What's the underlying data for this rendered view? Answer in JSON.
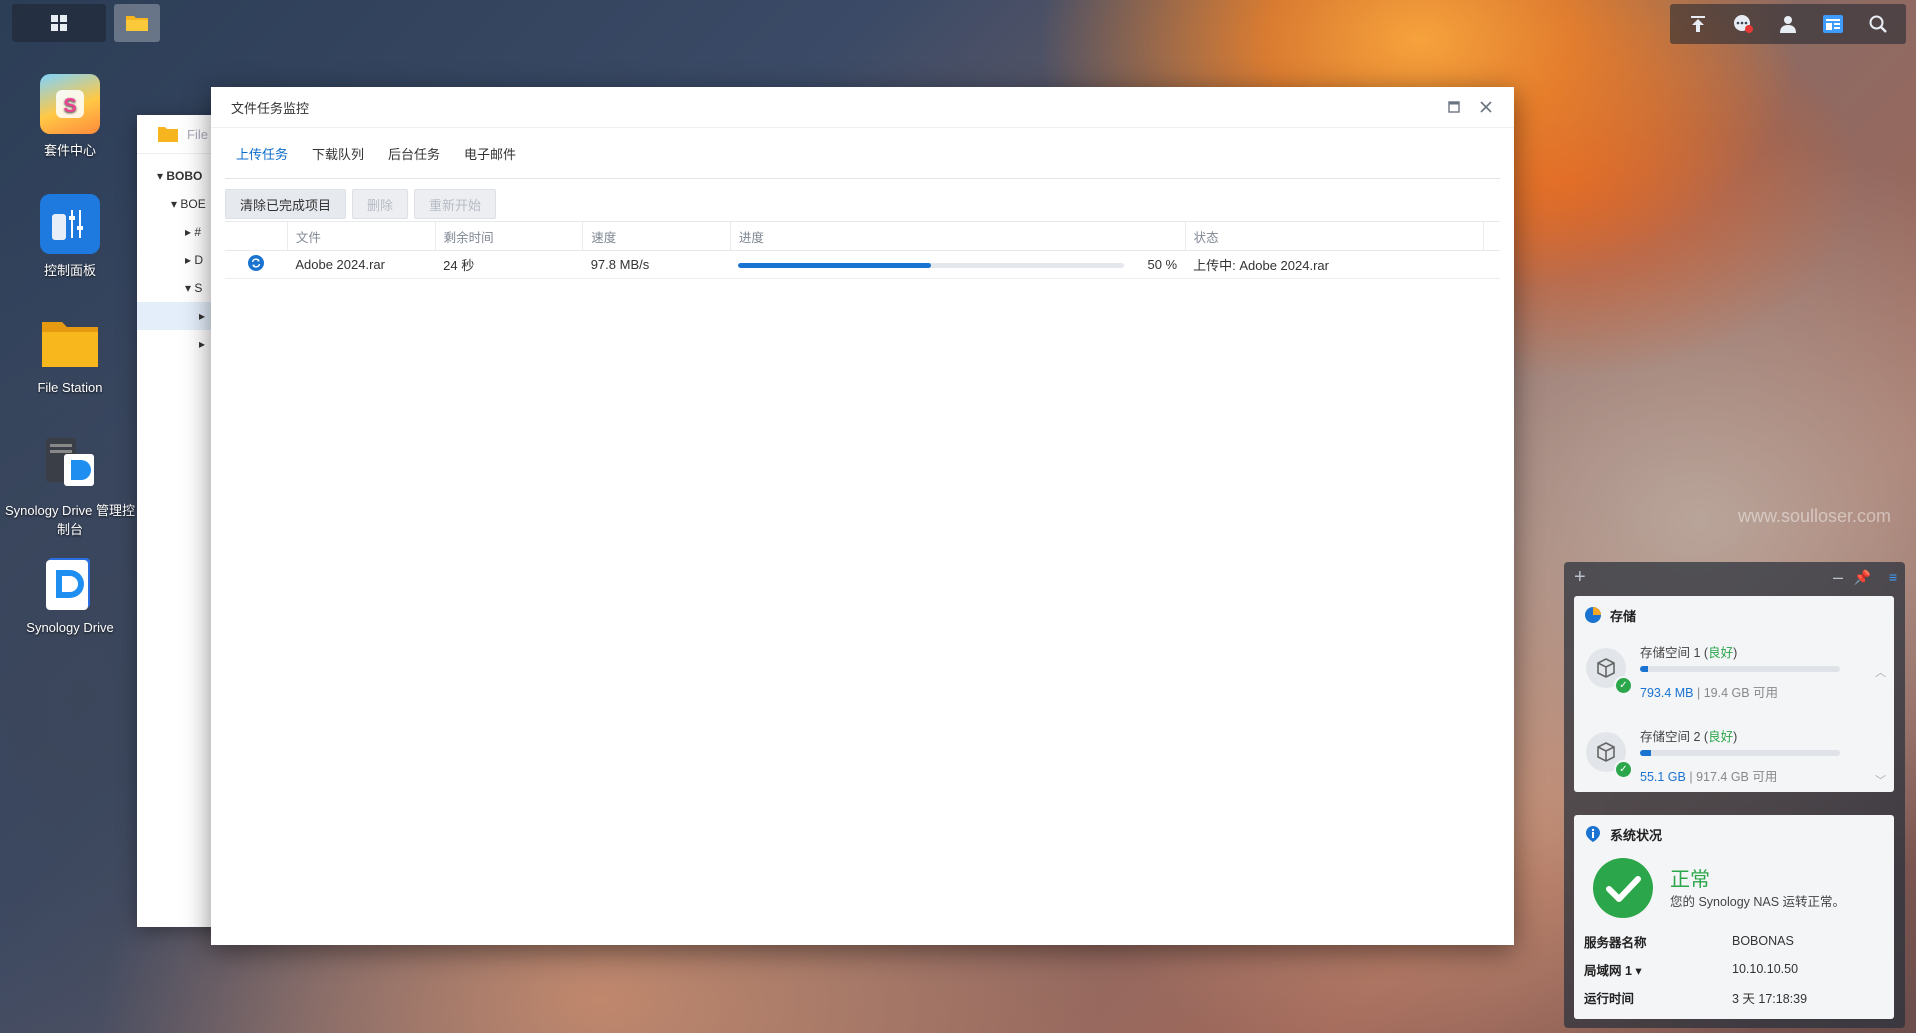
{
  "desktop": {
    "icons": [
      {
        "label": "套件中心"
      },
      {
        "label": "控制面板"
      },
      {
        "label": "File Station"
      },
      {
        "label": "Synology Drive 管理控制台"
      },
      {
        "label": "Synology Drive"
      }
    ],
    "watermark": "www.soulloser.com"
  },
  "file_station_bg": {
    "title": "File",
    "tree": [
      "BOBO",
      "BOE",
      "#",
      "D",
      "S",
      "",
      ""
    ]
  },
  "window": {
    "title": "文件任务监控",
    "tabs": [
      "上传任务",
      "下载队列",
      "后台任务",
      "电子邮件"
    ],
    "active_tab": "上传任务",
    "toolbar": {
      "clear_label": "清除已完成项目",
      "delete_label": "删除",
      "restart_label": "重新开始"
    },
    "columns": [
      "文件",
      "剩余时间",
      "速度",
      "进度",
      "状态"
    ],
    "rows": [
      {
        "file": "Adobe 2024.rar",
        "remaining": "24 秒",
        "speed": "97.8 MB/s",
        "progress": 50,
        "progress_label": "50 %",
        "status": "上传中: Adobe 2024.rar"
      }
    ]
  },
  "widgets": {
    "storage": {
      "title": "存储",
      "volumes": [
        {
          "name": "存储空间 1",
          "status": "良好",
          "used": "793.4 MB",
          "free": "19.4 GB 可用",
          "usage_fraction": 0.04
        },
        {
          "name": "存储空间 2",
          "status": "良好",
          "used": "55.1 GB",
          "free": "917.4 GB 可用",
          "usage_fraction": 0.057
        }
      ]
    },
    "system": {
      "title": "系统状况",
      "state": "正常",
      "message": "您的 Synology NAS 运转正常。",
      "rows": [
        {
          "key": "服务器名称",
          "value": "BOBONAS"
        },
        {
          "key": "局域网 1 ▾",
          "value": "10.10.10.50"
        },
        {
          "key": "运行时间",
          "value": "3 天 17:18:39"
        }
      ]
    }
  },
  "colors": {
    "accent": "#1a73d0",
    "ok": "#2ca64a"
  }
}
